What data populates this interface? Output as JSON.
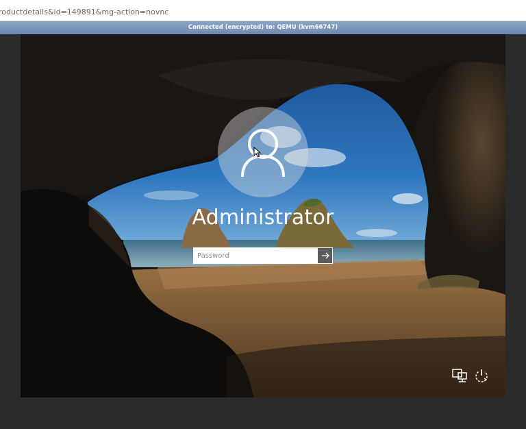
{
  "browser": {
    "url": "roductdetails&id=149891&mg-action=novnc"
  },
  "novnc": {
    "status": "Connected (encrypted) to: QEMU (kvm66747)"
  },
  "login": {
    "username": "Administrator",
    "password_value": "",
    "password_placeholder": "Password"
  },
  "icons": {
    "avatar": "user-avatar-icon",
    "submit": "arrow-right-icon",
    "network": "network-icon",
    "power": "power-icon",
    "cursor": "mouse-pointer-icon"
  },
  "colors": {
    "status_bar": "#7894b8",
    "submit_button": "#5c5c5c",
    "page_background": "#2b2b2b"
  }
}
